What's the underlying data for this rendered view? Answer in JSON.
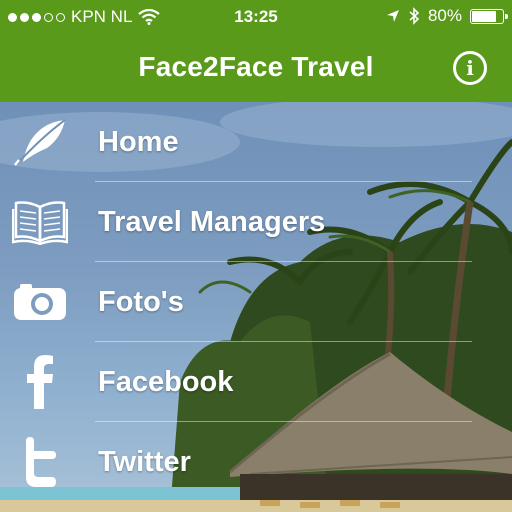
{
  "status_bar": {
    "carrier": "KPN NL",
    "time": "13:25",
    "battery": "80%",
    "battery_level": 0.8,
    "signal_bars_filled": 3,
    "signal_bars_total": 5
  },
  "nav": {
    "title": "Face2Face Travel",
    "info_label": "i"
  },
  "colors": {
    "brand_green": "#5a9a1a"
  },
  "menu": [
    {
      "label": "Home",
      "icon": "feather-icon"
    },
    {
      "label": "Travel Managers",
      "icon": "open-book-icon"
    },
    {
      "label": "Foto's",
      "icon": "camera-icon"
    },
    {
      "label": "Facebook",
      "icon": "facebook-icon"
    },
    {
      "label": "Twitter",
      "icon": "twitter-icon"
    }
  ]
}
